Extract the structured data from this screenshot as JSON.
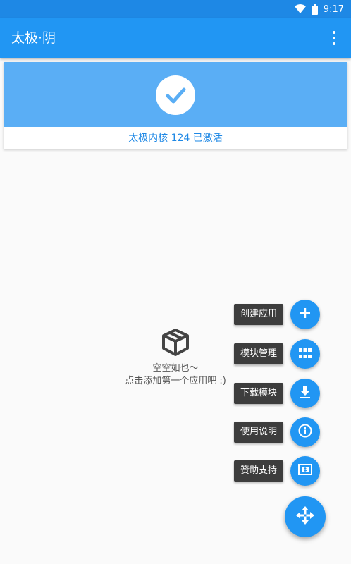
{
  "status_bar": {
    "time": "9:17",
    "wifi_icon": "wifi-icon",
    "battery_icon": "battery-icon"
  },
  "app_bar": {
    "title": "太极·阴",
    "menu_icon": "more-vertical-icon"
  },
  "status_card": {
    "icon": "check-icon",
    "text": "太极内核 124 已激活",
    "color": "#1e88e5"
  },
  "empty_state": {
    "icon": "empty-box-icon",
    "line1": "空空如也～",
    "line2": "点击添加第一个应用吧 :)"
  },
  "fab_menu": {
    "items": [
      {
        "label": "创建应用",
        "icon": "plus-icon"
      },
      {
        "label": "模块管理",
        "icon": "grid-icon"
      },
      {
        "label": "下载模块",
        "icon": "download-icon"
      },
      {
        "label": "使用说明",
        "icon": "info-icon"
      },
      {
        "label": "赞助支持",
        "icon": "money-icon"
      }
    ],
    "main_icon": "move-arrows-icon",
    "accent": "#2196f3"
  }
}
